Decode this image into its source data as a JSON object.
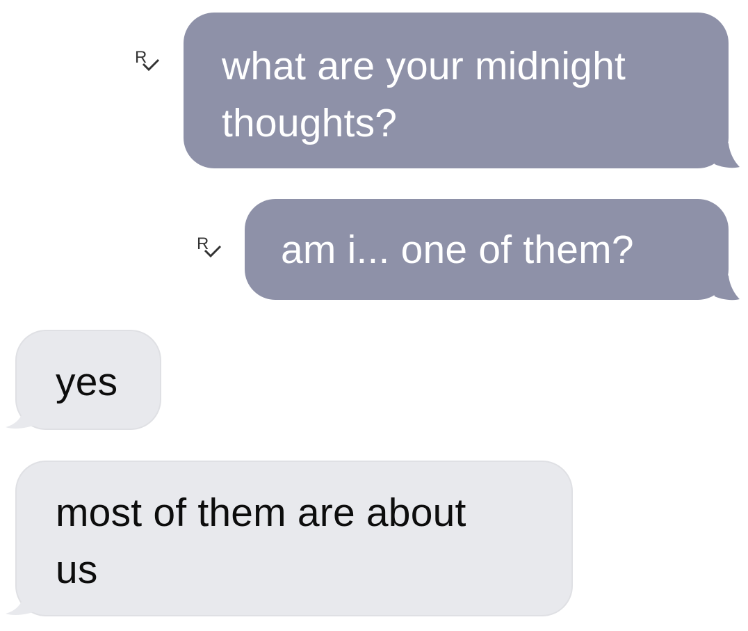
{
  "conversation": {
    "messages": [
      {
        "direction": "sent",
        "text": "what are your midnight\nthoughts?",
        "receipt_icon": "read-receipt-icon"
      },
      {
        "direction": "sent",
        "text": "am i... one of them?",
        "receipt_icon": "read-receipt-icon"
      },
      {
        "direction": "received",
        "text": "yes"
      },
      {
        "direction": "received",
        "text": "most of them are about\nus"
      }
    ]
  },
  "colors": {
    "sent_bubble": "#8e91a8",
    "sent_text": "#ffffff",
    "received_bubble": "#e8e9ed",
    "received_text": "#0d0d0d",
    "background": "#ffffff",
    "receipt_icon": "#333333"
  }
}
